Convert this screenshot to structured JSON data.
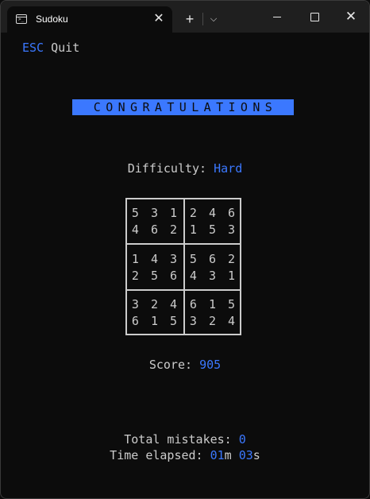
{
  "window": {
    "tab_title": "Sudoku",
    "tab_close": "✕",
    "new_tab": "+",
    "dropdown": "⌵",
    "close": "✕",
    "icons": [
      "terminal-icon",
      "close-icon",
      "plus-icon",
      "chevron-down-icon",
      "minimize-icon",
      "maximize-icon",
      "close-icon"
    ]
  },
  "terminal": {
    "esc_key": "ESC",
    "esc_action": "Quit",
    "banner": "CONGRATULATIONS",
    "difficulty_label": "Difficulty:",
    "difficulty_value": "Hard",
    "grid": [
      [
        "5 3 1",
        "4 6 2"
      ],
      [
        "2 4 6",
        "1 5 3"
      ],
      [
        "1 4 3",
        "2 5 6"
      ],
      [
        "5 6 2",
        "4 3 1"
      ],
      [
        "3 2 4",
        "6 1 5"
      ],
      [
        "6 1 5",
        "3 2 4"
      ]
    ],
    "score_label": "Score:",
    "score_value": "905",
    "mistakes_label": "Total mistakes:",
    "mistakes_value": "0",
    "elapsed_label": "Time elapsed:",
    "elapsed_minutes": "01",
    "elapsed_minutes_unit": "m",
    "elapsed_seconds": "03",
    "elapsed_seconds_unit": "s"
  },
  "colors": {
    "accent": "#3b78ff",
    "text": "#cccccc",
    "background": "#0c0c0c",
    "titlebar": "#1f1f1f"
  }
}
